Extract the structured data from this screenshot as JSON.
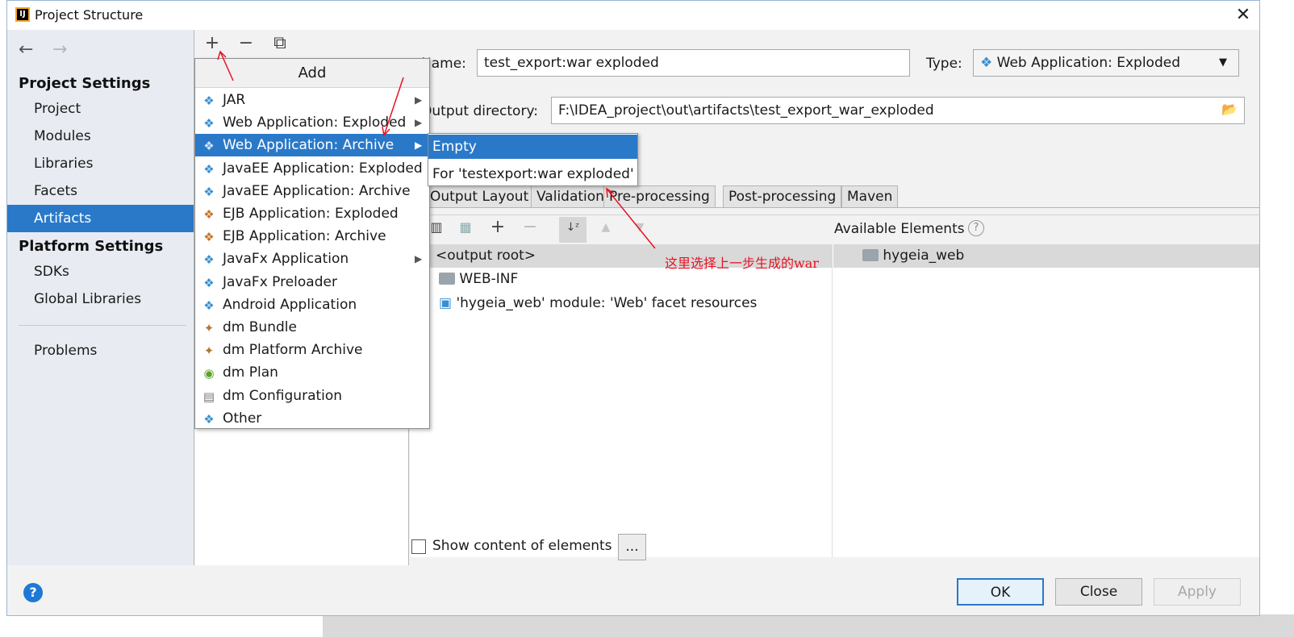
{
  "window": {
    "title": "Project Structure",
    "close_glyph": "✕"
  },
  "left_nav": {
    "back_glyph": "←",
    "forward_glyph": "→",
    "project_settings_label": "Project Settings",
    "project_items": [
      "Project",
      "Modules",
      "Libraries",
      "Facets",
      "Artifacts"
    ],
    "selected_item": "Artifacts",
    "platform_settings_label": "Platform Settings",
    "platform_items": [
      "SDKs",
      "Global Libraries"
    ],
    "problems_label": "Problems"
  },
  "mid_toolbar": {
    "add_glyph": "+",
    "remove_glyph": "−",
    "copy_glyph": "⧉"
  },
  "form": {
    "name_label": "Name:",
    "name_value": "test_export:war exploded",
    "type_label": "Type:",
    "type_value": "Web Application: Exploded",
    "output_label": "Output directory:",
    "output_value": "F:\\IDEA_project\\out\\artifacts\\test_export_war_exploded"
  },
  "tabs": [
    "Output Layout",
    "Validation",
    "Pre-processing",
    "Post-processing",
    "Maven"
  ],
  "layout": {
    "available_label": "Available Elements",
    "tree_rows": [
      "<output root>",
      "WEB-INF",
      "'hygeia_web' module: 'Web' facet resources"
    ],
    "available_rows": [
      "hygeia_web"
    ],
    "show_content_label": "Show content of elements",
    "more_label": "..."
  },
  "buttons": {
    "ok": "OK",
    "close": "Close",
    "apply": "Apply",
    "help": "?"
  },
  "add_menu": {
    "title": "Add",
    "items": [
      {
        "label": "JAR",
        "icon": "artifact-icon",
        "submenu": true
      },
      {
        "label": "Web Application: Exploded",
        "icon": "web-artifact-icon",
        "submenu": true
      },
      {
        "label": "Web Application: Archive",
        "icon": "web-artifact-icon",
        "submenu": true
      },
      {
        "label": "JavaEE Application: Exploded",
        "icon": "javaee-icon",
        "submenu": false
      },
      {
        "label": "JavaEE Application: Archive",
        "icon": "javaee-icon",
        "submenu": false
      },
      {
        "label": "EJB Application: Exploded",
        "icon": "ejb-icon",
        "submenu": false
      },
      {
        "label": "EJB Application: Archive",
        "icon": "ejb-icon",
        "submenu": false
      },
      {
        "label": "JavaFx Application",
        "icon": "artifact-icon",
        "submenu": true
      },
      {
        "label": "JavaFx Preloader",
        "icon": "artifact-icon",
        "submenu": false
      },
      {
        "label": "Android Application",
        "icon": "artifact-icon",
        "submenu": false
      },
      {
        "label": "dm Bundle",
        "icon": "bundle-icon",
        "submenu": false
      },
      {
        "label": "dm Platform Archive",
        "icon": "bundle-icon",
        "submenu": false
      },
      {
        "label": "dm Plan",
        "icon": "plan-icon",
        "submenu": false
      },
      {
        "label": "dm Configuration",
        "icon": "config-file-icon",
        "submenu": false
      },
      {
        "label": "Other",
        "icon": "artifact-icon",
        "submenu": false
      }
    ],
    "highlighted": "Web Application: Archive"
  },
  "sub_menu": {
    "items": [
      "Empty",
      "For 'testexport:war exploded'"
    ],
    "highlighted": "Empty"
  },
  "annotation": {
    "text": "这里选择上一步生成的war",
    "color": "#e81123"
  },
  "colors": {
    "accent": "#2a79c9",
    "annotation": "#e81123"
  }
}
